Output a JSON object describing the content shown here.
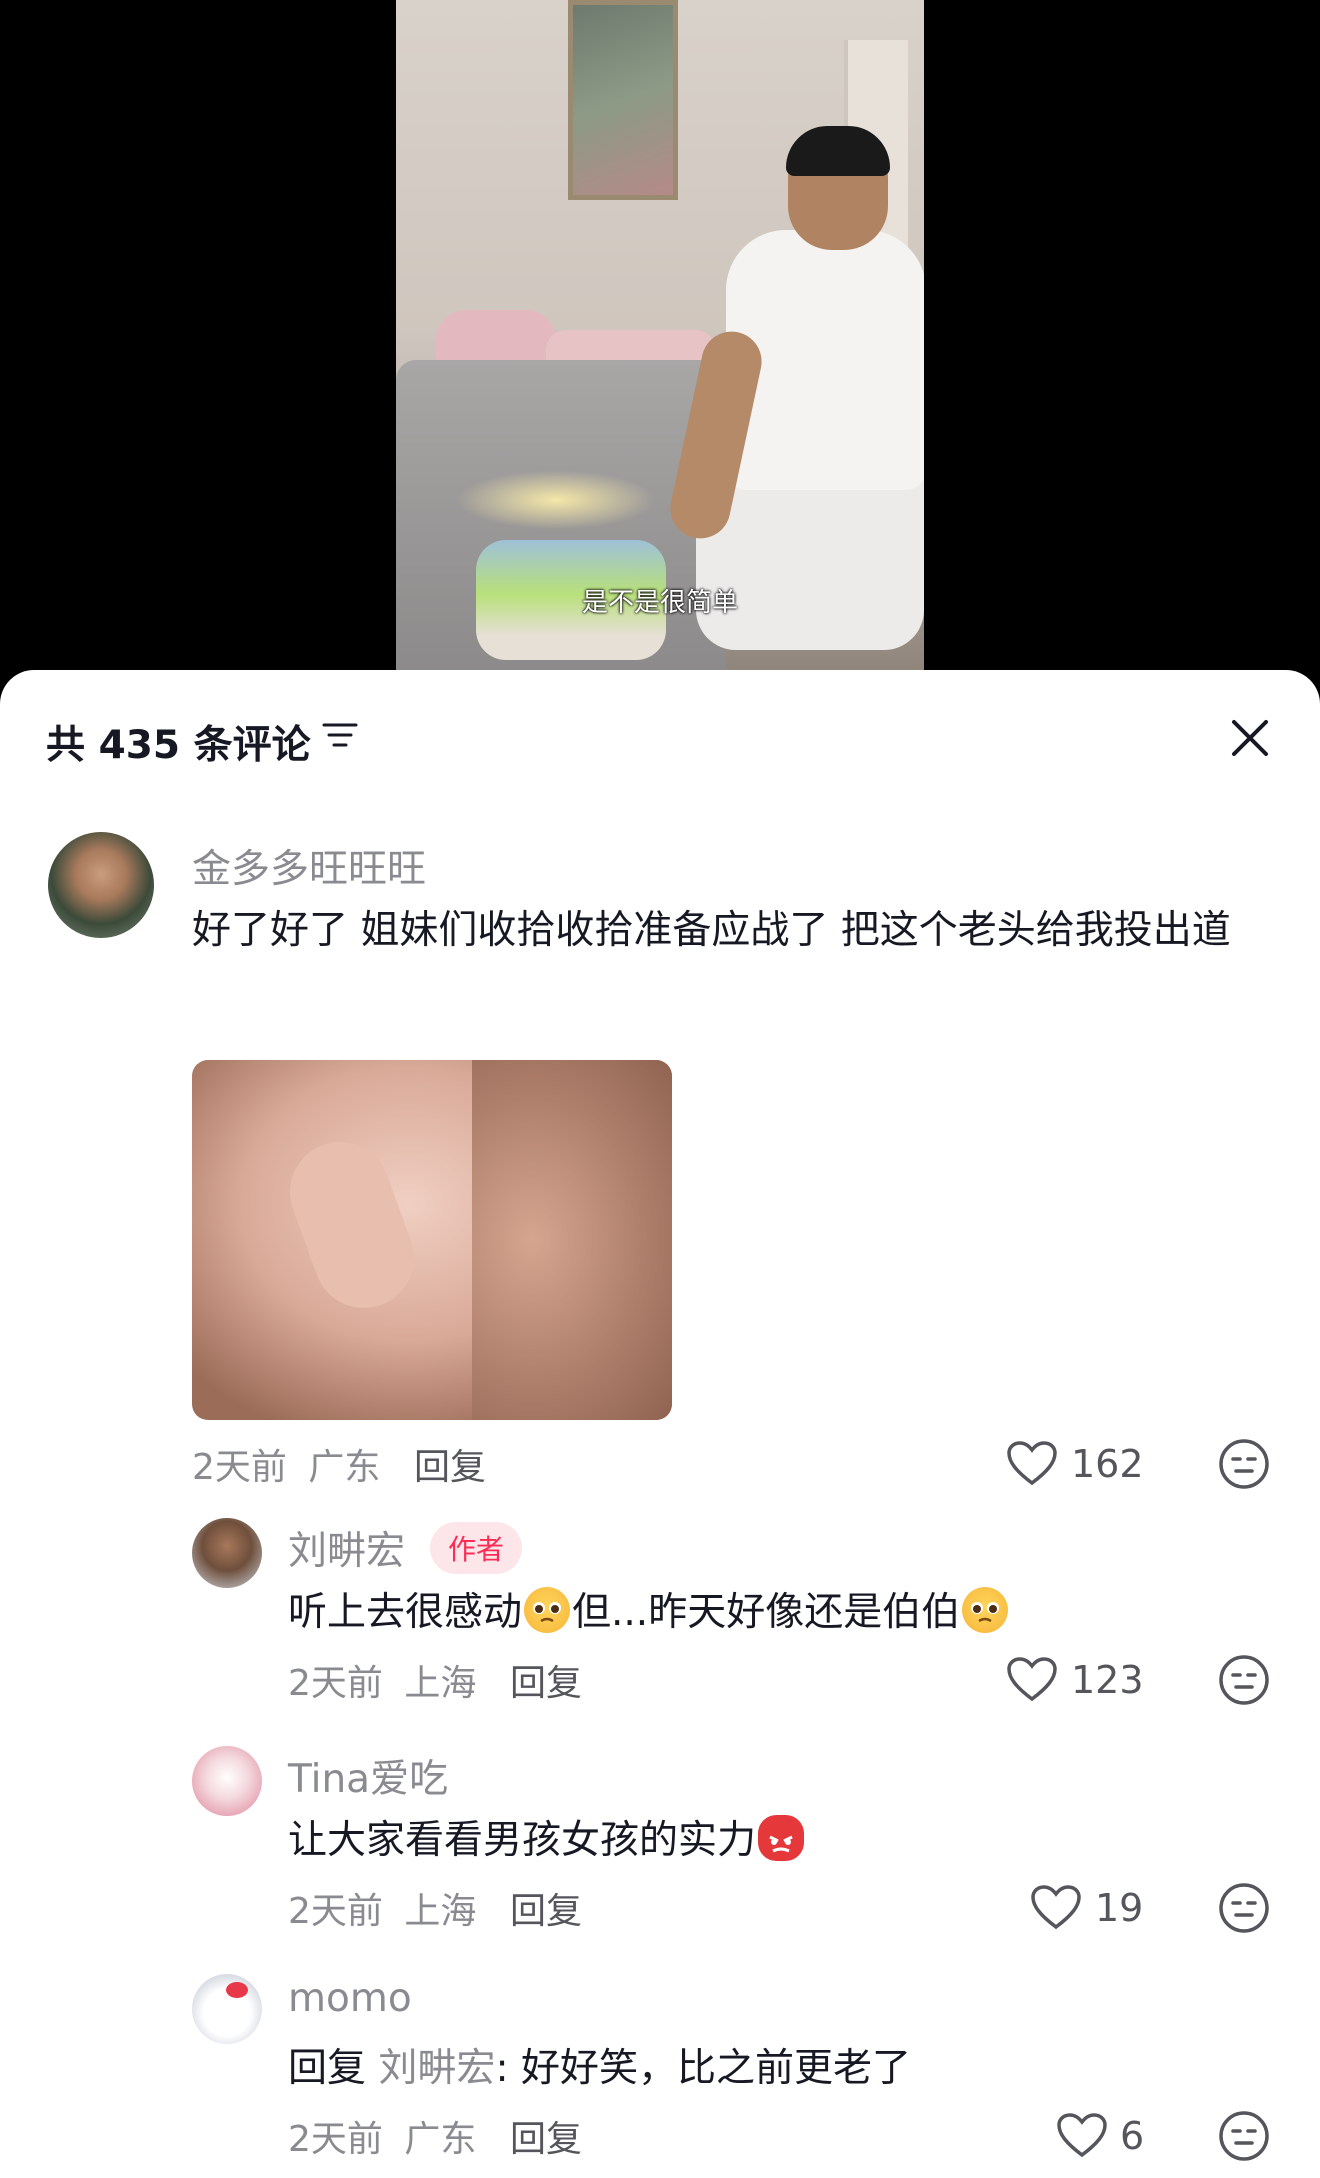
{
  "video": {
    "subtitle": "是不是很简单"
  },
  "comments_panel": {
    "title": "共 435 条评论",
    "filter_icon": "filter-icon",
    "close_icon": "close-icon"
  },
  "comments": [
    {
      "username": "金多多旺旺旺",
      "text": "好了好了 姐妹们收拾收拾准备应战了 把这个老头给我投出道",
      "has_image": true,
      "time": "2天前",
      "location": "广东",
      "reply_label": "回复",
      "likes": "162"
    },
    {
      "username": "刘畊宏",
      "badge": "作者",
      "text_part1": "听上去很感动",
      "text_part2": "但...昨天好像还是伯伯",
      "time": "2天前",
      "location": "上海",
      "reply_label": "回复",
      "likes": "123"
    },
    {
      "username": "Tina爱吃",
      "text": "让大家看看男孩女孩的实力",
      "time": "2天前",
      "location": "上海",
      "reply_label": "回复",
      "likes": "19"
    },
    {
      "username": "momo",
      "reply_prefix": "回复",
      "reply_to": "刘畊宏",
      "text": ": 好好笑，比之前更老了",
      "time": "2天前",
      "location": "广东",
      "reply_label": "回复",
      "likes": "6"
    }
  ],
  "colors": {
    "accent": "#fe2c55",
    "text_primary": "#161823",
    "text_secondary": "#8a8b91"
  }
}
